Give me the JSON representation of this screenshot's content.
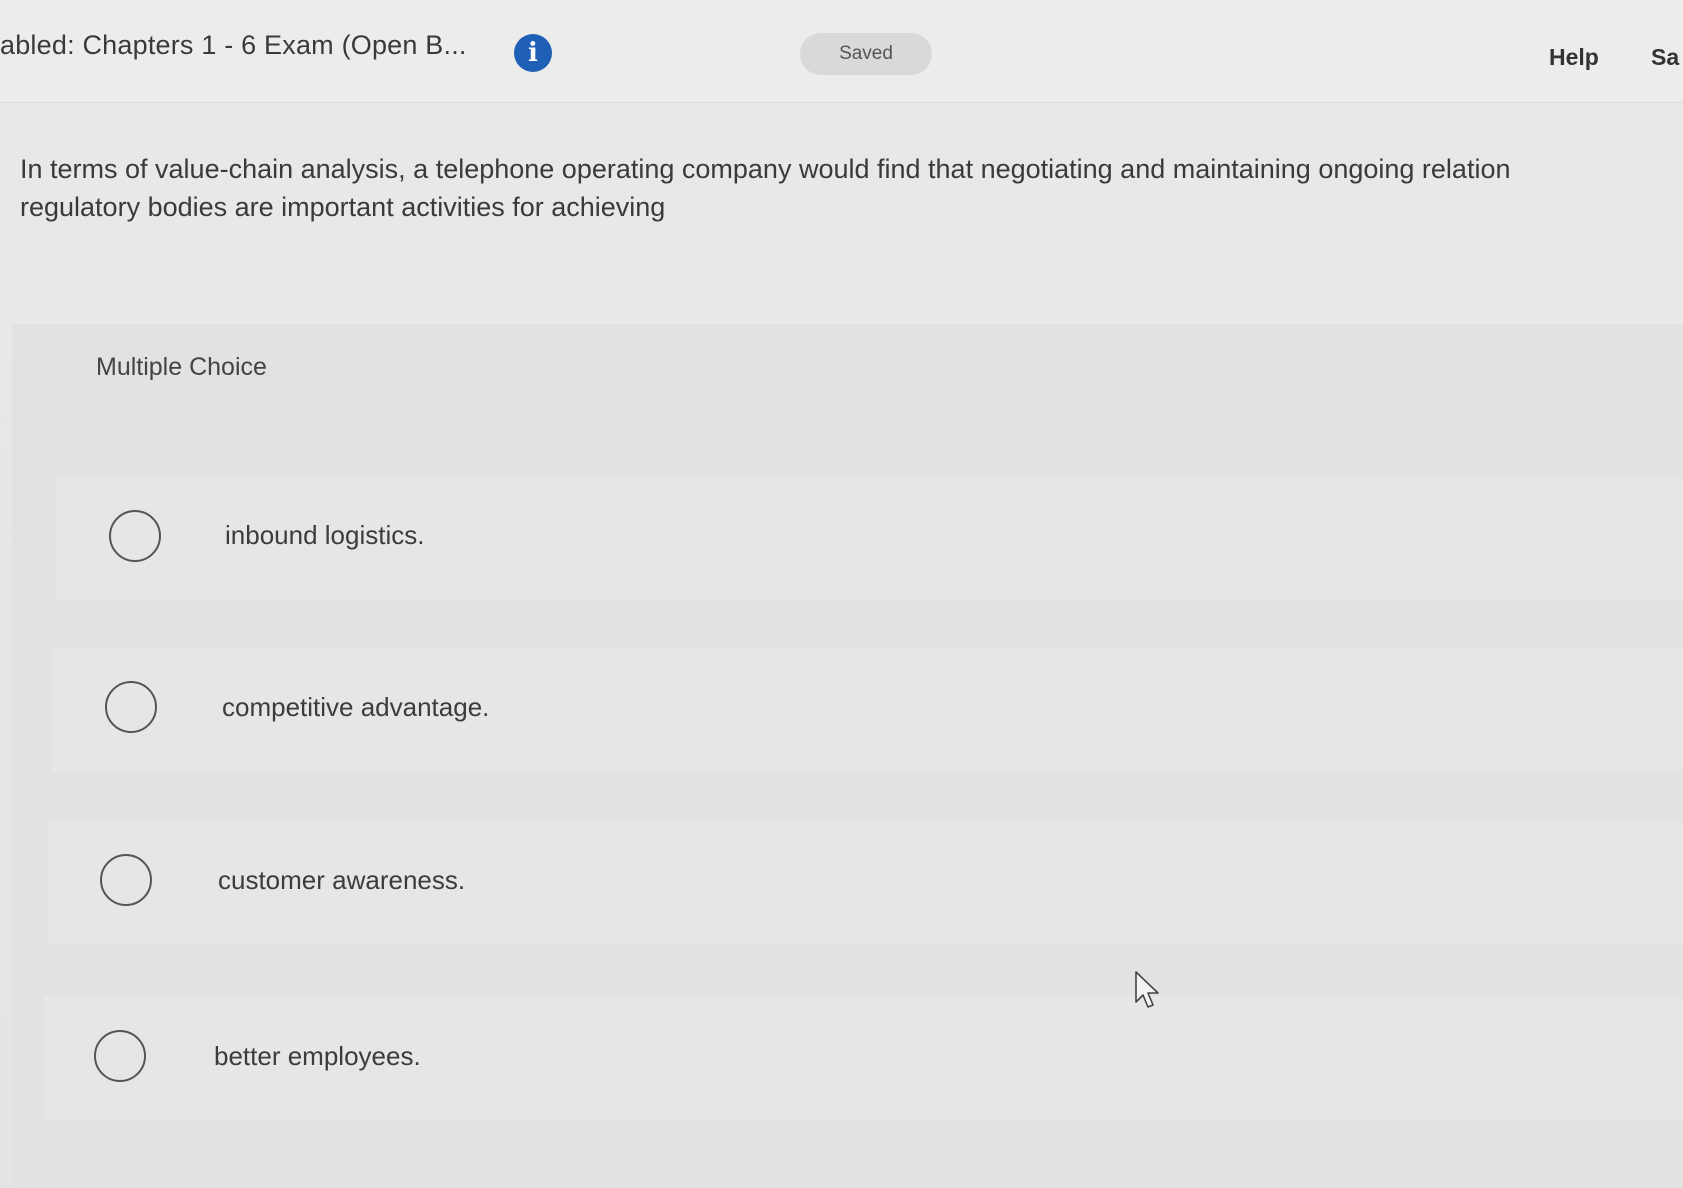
{
  "header": {
    "exam_title": "abled: Chapters 1 - 6 Exam (Open B...",
    "info_icon": "info-icon",
    "saved_label": "Saved",
    "help_label": "Help",
    "save_label": "Sa"
  },
  "question": {
    "line1": "In terms of value-chain analysis, a telephone operating company would find that negotiating and maintaining ongoing relation",
    "line2": "regulatory bodies are important activities for achieving"
  },
  "answer_panel": {
    "type_label": "Multiple Choice",
    "options": [
      {
        "label": "inbound logistics.",
        "selected": false
      },
      {
        "label": "competitive advantage.",
        "selected": false
      },
      {
        "label": "customer awareness.",
        "selected": false
      },
      {
        "label": "better employees.",
        "selected": false
      }
    ]
  },
  "colors": {
    "info_icon_bg": "#1f5fb5",
    "saved_pill_bg": "#d9d9d7",
    "background": "#e7e7e5"
  }
}
